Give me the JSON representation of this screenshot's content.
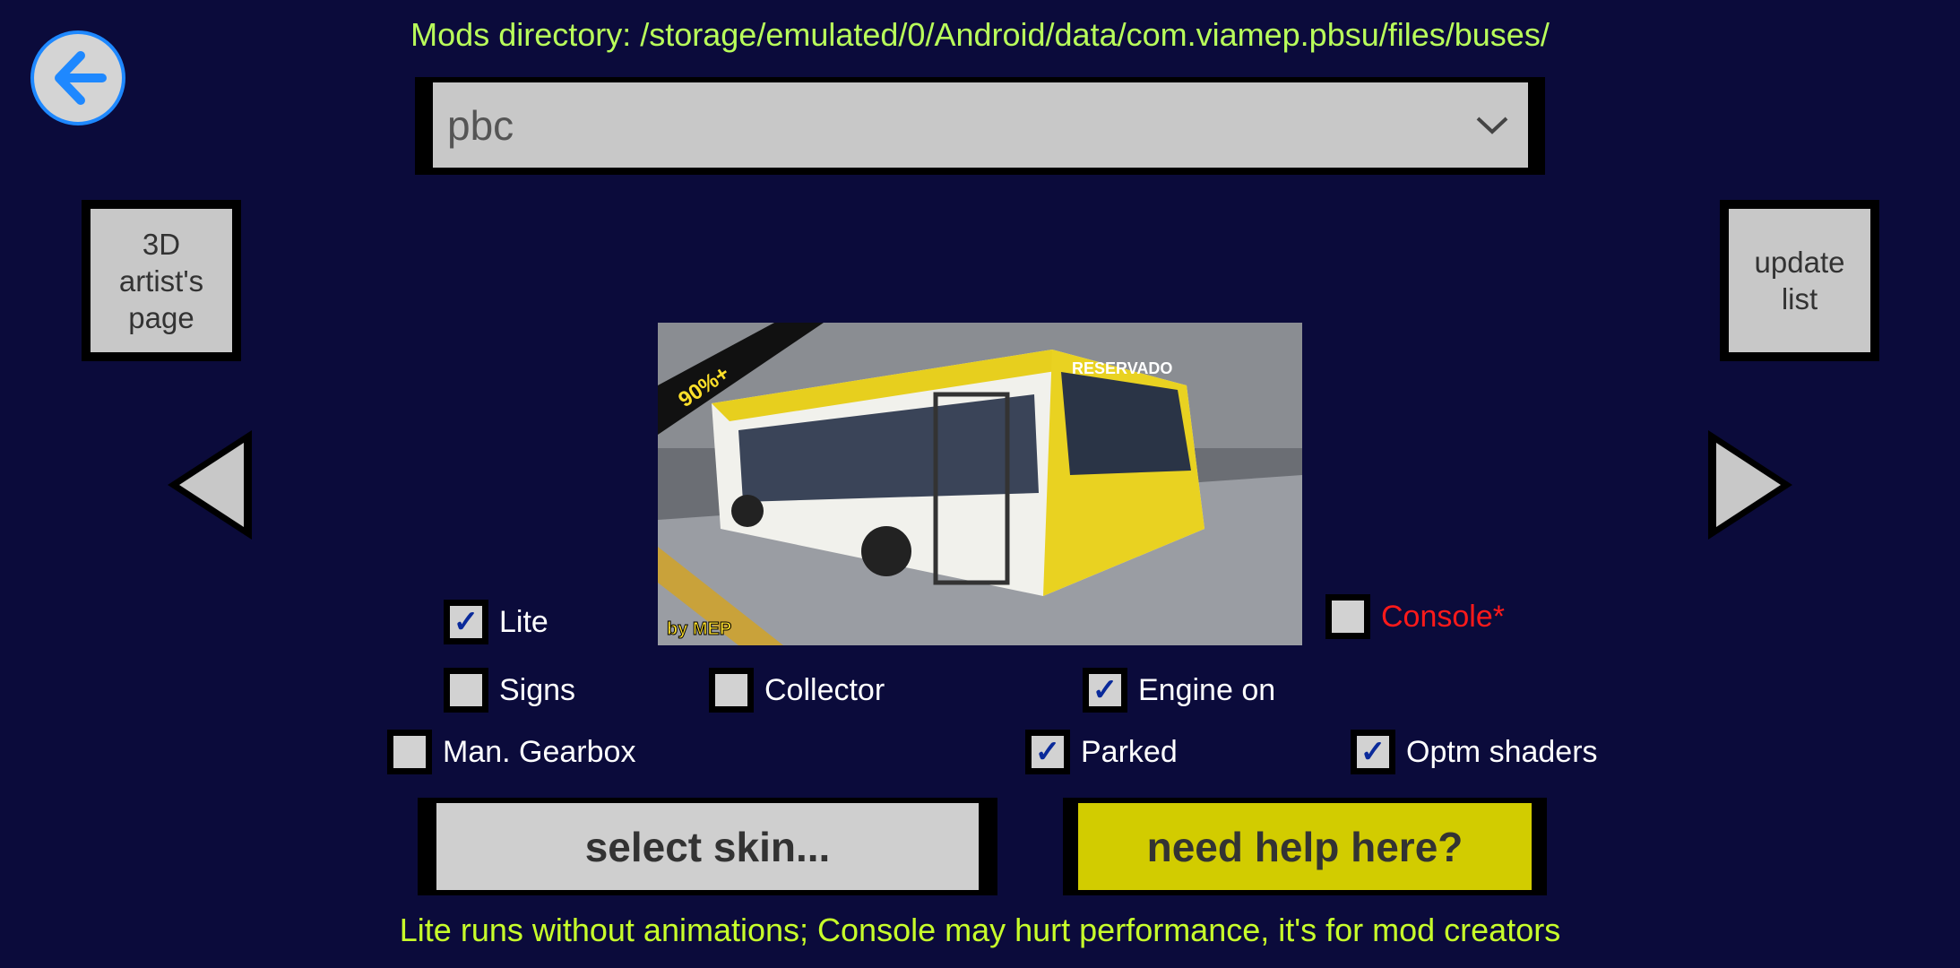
{
  "header": {
    "mods_directory": "Mods directory: /storage/emulated/0/Android/data/com.viamep.pbsu/files/buses/"
  },
  "back_icon": "arrow-left-circle-icon",
  "bus_selector": {
    "selected": "pbc"
  },
  "buttons": {
    "artist_page": "3D artist's page",
    "update_list": "update list",
    "select_skin": "select skin...",
    "need_help": "need help here?"
  },
  "preview": {
    "badge": "90%+",
    "credit": "by MEP",
    "sign": "RESERVADO"
  },
  "options": [
    {
      "label": "Lite",
      "checked": true
    },
    {
      "label": "Console*",
      "checked": false,
      "color": "#ff1a1a"
    },
    {
      "label": "Signs",
      "checked": false
    },
    {
      "label": "Collector",
      "checked": false
    },
    {
      "label": "Engine on",
      "checked": true
    },
    {
      "label": "Man. Gearbox",
      "checked": false
    },
    {
      "label": "Parked",
      "checked": true
    },
    {
      "label": "Optm shaders",
      "checked": true
    }
  ],
  "footer": {
    "hint": "Lite runs without animations; Console may hurt performance, it's for mod creators"
  },
  "colors": {
    "background": "#0b0b3b",
    "title": "#b9ff5a",
    "help_button": "#d2cc00",
    "back_ring": "#1e88ff"
  }
}
